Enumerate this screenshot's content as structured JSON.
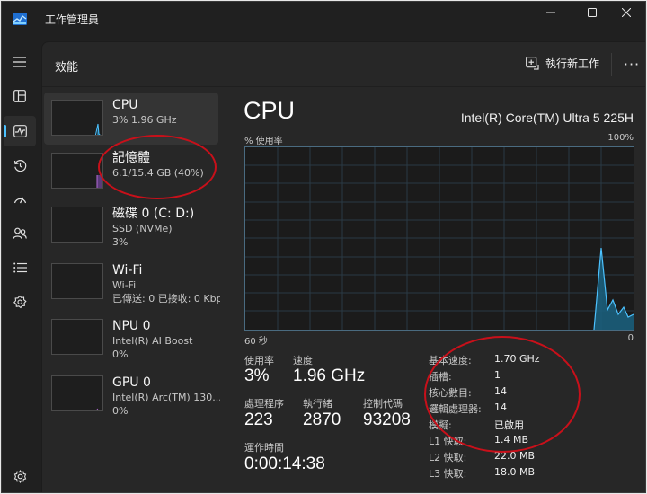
{
  "window": {
    "title": "工作管理員",
    "accent": "#4cc2ff",
    "controls": [
      "minimize-icon",
      "maximize-icon",
      "close-icon"
    ]
  },
  "nav": {
    "items": [
      {
        "name": "menu-icon"
      },
      {
        "name": "processes-icon"
      },
      {
        "name": "performance-icon",
        "active": true
      },
      {
        "name": "app-history-icon"
      },
      {
        "name": "startup-apps-icon"
      },
      {
        "name": "users-icon"
      },
      {
        "name": "details-icon"
      },
      {
        "name": "services-icon"
      }
    ],
    "settings": "settings-icon"
  },
  "header": {
    "title": "效能",
    "run_task": "執行新工作",
    "more": "···"
  },
  "resources": [
    {
      "name": "CPU",
      "sub1": "3%  1.96 GHz",
      "selected": true
    },
    {
      "name": "記憶體",
      "sub1": "6.1/15.4 GB (40%)"
    },
    {
      "name": "磁碟 0 (C: D:)",
      "sub1": "SSD (NVMe)",
      "sub2": "3%"
    },
    {
      "name": "Wi-Fi",
      "sub1": "Wi-Fi",
      "sub2": "已傳送: 0 已接收: 0 Kbps"
    },
    {
      "name": "NPU 0",
      "sub1": "Intel(R) AI Boost",
      "sub2": "0%"
    },
    {
      "name": "GPU 0",
      "sub1": "Intel(R) Arc(TM) 130...",
      "sub2": "0%"
    }
  ],
  "detail": {
    "title": "CPU",
    "model": "Intel(R) Core(TM) Ultra 5 225H",
    "usage_label": "% 使用率",
    "max_label": "100%",
    "axis_left": "60 秒",
    "axis_right": "0",
    "utilization_label": "使用率",
    "utilization": "3%",
    "speed_label": "速度",
    "speed": "1.96 GHz",
    "processes_label": "處理程序",
    "processes": "223",
    "threads_label": "執行緒",
    "threads": "2870",
    "handles_label": "控制代碼",
    "handles": "93208",
    "uptime_label": "運作時間",
    "uptime": "0:00:14:38",
    "specs": [
      {
        "k": "基本速度:",
        "v": "1.70 GHz"
      },
      {
        "k": "插槽:",
        "v": "1"
      },
      {
        "k": "核心數目:",
        "v": "14"
      },
      {
        "k": "邏輯處理器:",
        "v": "14"
      },
      {
        "k": "模擬:",
        "v": "已啟用"
      },
      {
        "k": "L1 快取:",
        "v": "1.4 MB"
      },
      {
        "k": "L2 快取:",
        "v": "22.0 MB"
      },
      {
        "k": "L3 快取:",
        "v": "18.0 MB"
      }
    ]
  },
  "annotations": {
    "color": "#c8101a"
  }
}
